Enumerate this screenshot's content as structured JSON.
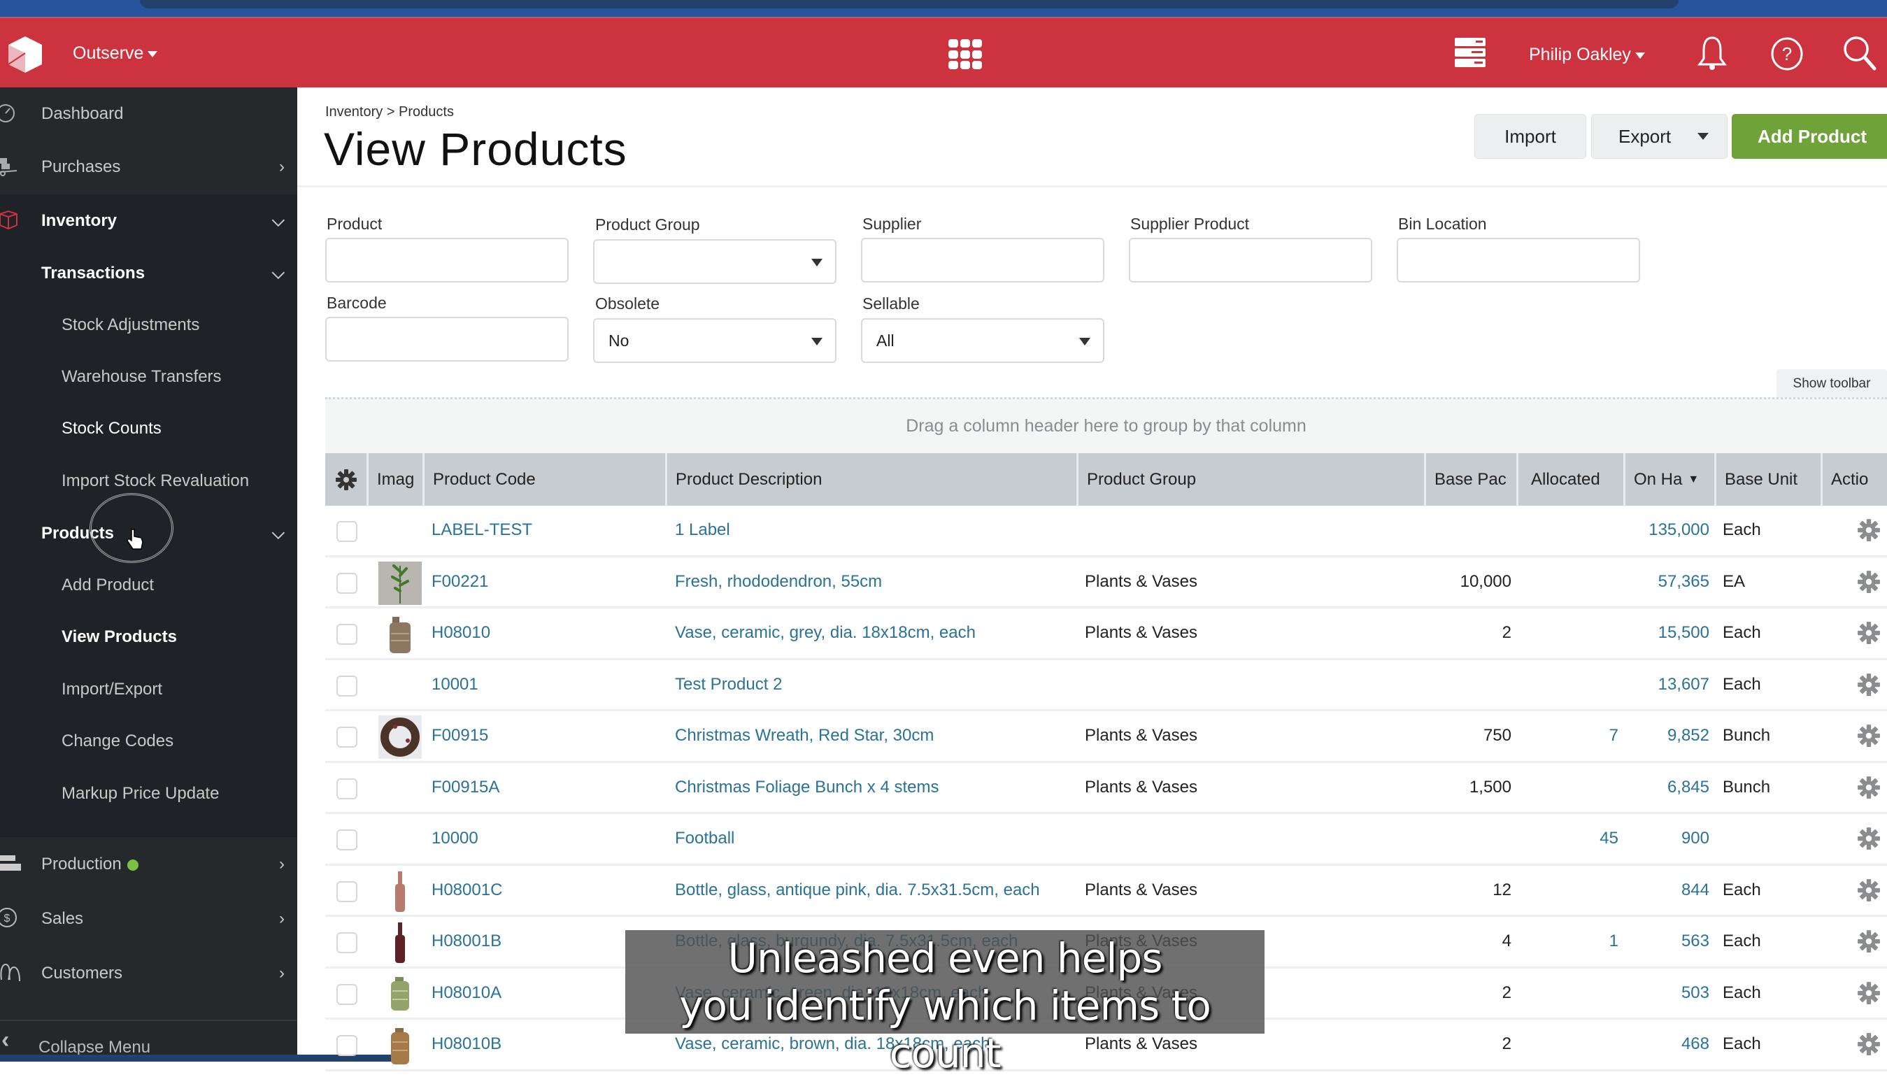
{
  "header": {
    "org_name": "Outserve",
    "user_name": "Philip Oakley",
    "icons": [
      "app-logo-cube",
      "apps-grid-icon",
      "server-stack-icon",
      "bell-icon",
      "help-icon",
      "search-icon"
    ]
  },
  "sidebar": {
    "items": [
      {
        "label": "Dashboard",
        "icon": "dashboard-gauge-icon"
      },
      {
        "label": "Purchases",
        "icon": "hand-truck-icon"
      },
      {
        "label": "Inventory",
        "icon": "box-icon"
      },
      {
        "label": "Transactions"
      },
      {
        "label": "Stock Adjustments"
      },
      {
        "label": "Warehouse Transfers"
      },
      {
        "label": "Stock Counts"
      },
      {
        "label": "Import Stock Revaluation"
      },
      {
        "label": "Products"
      },
      {
        "label": "Add Product"
      },
      {
        "label": "View Products"
      },
      {
        "label": "Import/Export"
      },
      {
        "label": "Change Codes"
      },
      {
        "label": "Markup Price Update"
      },
      {
        "label": "Production",
        "icon": "factory-icon",
        "status_dot_color": "#7cc043"
      },
      {
        "label": "Sales",
        "icon": "dollar-circle-icon"
      },
      {
        "label": "Customers",
        "icon": "people-icon"
      }
    ],
    "collapse_label": "Collapse Menu"
  },
  "page": {
    "breadcrumb": "Inventory > Products",
    "title": "View Products",
    "buttons": {
      "import": "Import",
      "export": "Export",
      "add": "Add Product"
    }
  },
  "filters": {
    "product": {
      "label": "Product",
      "value": ""
    },
    "product_group": {
      "label": "Product Group",
      "value": ""
    },
    "supplier": {
      "label": "Supplier",
      "value": ""
    },
    "supplier_product": {
      "label": "Supplier Product",
      "value": ""
    },
    "bin_location": {
      "label": "Bin Location",
      "value": ""
    },
    "barcode": {
      "label": "Barcode",
      "value": ""
    },
    "obsolete": {
      "label": "Obsolete",
      "value": "No"
    },
    "sellable": {
      "label": "Sellable",
      "value": "All"
    }
  },
  "grid": {
    "show_toolbar": "Show toolbar",
    "group_hint": "Drag a column header here to group by that column",
    "columns": [
      "",
      "Imag",
      "Product Code",
      "Product Description",
      "Product Group",
      "Base Pac",
      "Allocated",
      "On Ha",
      "Base Unit",
      "Actio"
    ],
    "sorted_column": "On Ha",
    "rows": [
      {
        "code": "LABEL-TEST",
        "desc": "1 Label",
        "group": "",
        "base_pack": "",
        "allocated": "",
        "on_hand": "135,000",
        "unit": "Each",
        "image": ""
      },
      {
        "code": "F00221",
        "desc": "Fresh, rhododendron, 55cm",
        "group": "Plants & Vases",
        "base_pack": "10,000",
        "allocated": "",
        "on_hand": "57,365",
        "unit": "EA",
        "image": "plant"
      },
      {
        "code": "H08010",
        "desc": "Vase, ceramic, grey, dia. 18x18cm, each",
        "group": "Plants & Vases",
        "base_pack": "2",
        "allocated": "",
        "on_hand": "15,500",
        "unit": "Each",
        "image": "vase-grey"
      },
      {
        "code": "10001",
        "desc": "Test Product 2",
        "group": "",
        "base_pack": "",
        "allocated": "",
        "on_hand": "13,607",
        "unit": "Each",
        "image": ""
      },
      {
        "code": "F00915",
        "desc": "Christmas Wreath, Red Star, 30cm",
        "group": "Plants & Vases",
        "base_pack": "750",
        "allocated": "7",
        "on_hand": "9,852",
        "unit": "Bunch",
        "image": "wreath"
      },
      {
        "code": "F00915A",
        "desc": "Christmas Foliage Bunch x 4 stems",
        "group": "Plants & Vases",
        "base_pack": "1,500",
        "allocated": "",
        "on_hand": "6,845",
        "unit": "Bunch",
        "image": ""
      },
      {
        "code": "10000",
        "desc": "Football",
        "group": "",
        "base_pack": "",
        "allocated": "45",
        "on_hand": "900",
        "unit": "",
        "image": ""
      },
      {
        "code": "H08001C",
        "desc": "Bottle, glass, antique pink, dia. 7.5x31.5cm, each",
        "group": "Plants & Vases",
        "base_pack": "12",
        "allocated": "",
        "on_hand": "844",
        "unit": "Each",
        "image": "bottle-pink"
      },
      {
        "code": "H08001B",
        "desc": "Bottle, glass, burgundy, dia. 7.5x31.5cm, each",
        "group": "Plants & Vases",
        "base_pack": "4",
        "allocated": "1",
        "on_hand": "563",
        "unit": "Each",
        "image": "bottle-burgundy"
      },
      {
        "code": "H08010A",
        "desc": "Vase, ceramic, green, dia. 18x18cm, each",
        "group": "Plants & Vases",
        "base_pack": "2",
        "allocated": "",
        "on_hand": "503",
        "unit": "Each",
        "image": "vase-green"
      },
      {
        "code": "H08010B",
        "desc": "Vase, ceramic, brown, dia. 18x18cm, each",
        "group": "Plants & Vases",
        "base_pack": "2",
        "allocated": "",
        "on_hand": "468",
        "unit": "Each",
        "image": "vase-brown"
      }
    ]
  },
  "caption": {
    "line1": "Unleashed even helps",
    "line2": "you identify which items to count"
  },
  "colors": {
    "header_red": "#cd323f",
    "accent_green": "#70a23a",
    "link_blue": "#2a7396",
    "sidebar_bg": "#1f2226"
  }
}
